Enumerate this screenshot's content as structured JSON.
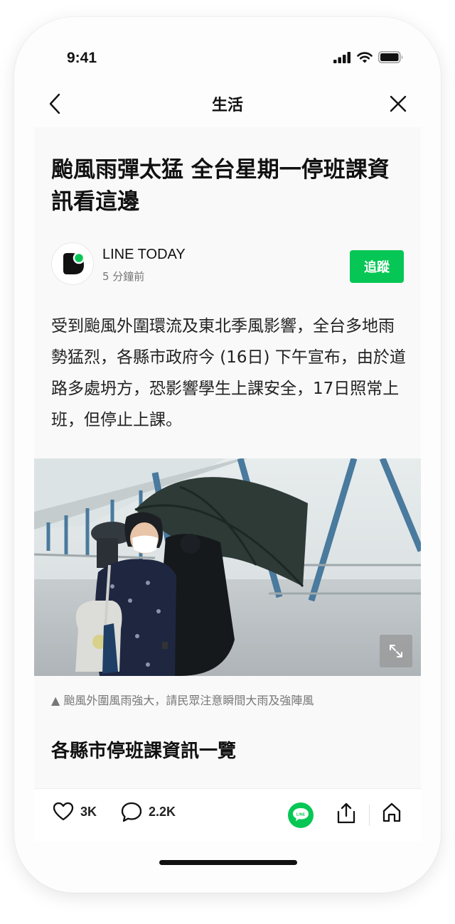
{
  "status_bar": {
    "time": "9:41"
  },
  "nav": {
    "title": "生活"
  },
  "article": {
    "headline": "颱風雨彈太猛 全台星期一停班課資訊看這邊",
    "publisher": {
      "name": "LINE TODAY",
      "time_ago": "5 分鐘前",
      "follow_label": "追蹤"
    },
    "body": "受到颱風外圍環流及東北季風影響，全台多地雨勢猛烈，各縣市政府今 (16日) 下午宣布，由於道路多處坍方，恐影響學生上課安全，17日照常上班，但停止上課。",
    "image_caption": "▲ 颱風外圍風雨強大，請民眾注意瞬間大雨及強陣風",
    "section_title": "各縣市停班課資訊一覽"
  },
  "actions": {
    "likes": "3K",
    "comments": "2.2K",
    "line_badge": "LINE"
  },
  "colors": {
    "brand_green": "#06c755",
    "text": "#111111",
    "muted": "#777777"
  }
}
